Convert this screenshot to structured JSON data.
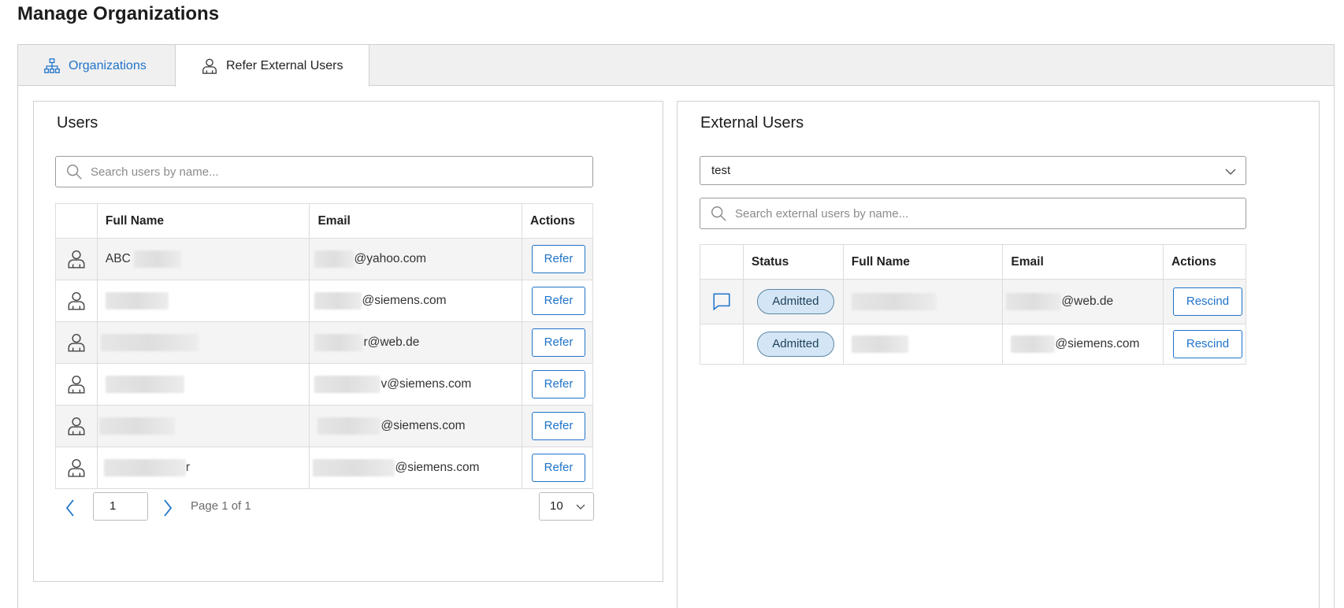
{
  "page": {
    "title": "Manage Organizations"
  },
  "tabs": [
    {
      "label": "Organizations",
      "icon": "org-chart-icon"
    },
    {
      "label": "Refer External Users",
      "icon": "user-icon"
    }
  ],
  "users_panel": {
    "title": "Users",
    "search_placeholder": "Search users by name...",
    "columns": [
      "",
      "Full Name",
      "Email",
      "Actions"
    ],
    "rows": [
      {
        "name": "ABC",
        "email": "@yahoo.com",
        "action": "Refer"
      },
      {
        "name": "",
        "email": "@siemens.com",
        "action": "Refer"
      },
      {
        "name": "",
        "email": "r@web.de",
        "action": "Refer"
      },
      {
        "name": "",
        "email": "v@siemens.com",
        "action": "Refer"
      },
      {
        "name": "",
        "email": "@siemens.com",
        "action": "Refer"
      },
      {
        "name": "r",
        "email": "@siemens.com",
        "action": "Refer"
      }
    ],
    "pagination": {
      "page_value": "1",
      "page_text": "Page 1 of 1",
      "page_size": "10"
    }
  },
  "external_panel": {
    "title": "External Users",
    "selected_org": "test",
    "search_placeholder": "Search external users by name...",
    "columns": [
      "",
      "Status",
      "Full Name",
      "Email",
      "Actions"
    ],
    "rows": [
      {
        "status": "Admitted",
        "name": "",
        "email": "@web.de",
        "action": "Rescind"
      },
      {
        "status": "Admitted",
        "name": "",
        "email": "@siemens.com",
        "action": "Rescind"
      }
    ]
  },
  "colors": {
    "accent": "#1f73c9",
    "badge_bg": "#d4e6f5",
    "badge_border": "#5a87a6",
    "row_shade": "#f4f4f4"
  }
}
